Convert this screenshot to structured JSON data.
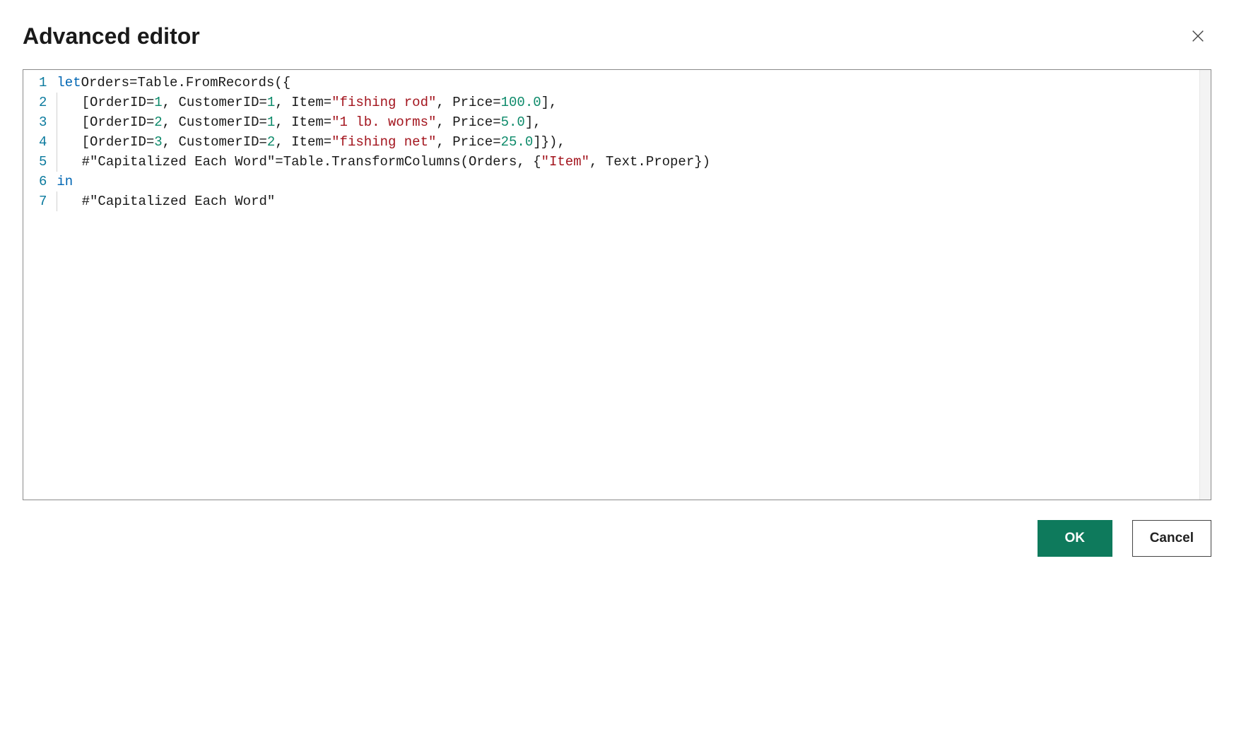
{
  "header": {
    "title": "Advanced editor"
  },
  "buttons": {
    "ok": "OK",
    "cancel": "Cancel"
  },
  "editor": {
    "line_numbers": [
      "1",
      "2",
      "3",
      "4",
      "5",
      "6",
      "7"
    ],
    "lines": [
      {
        "indent": 0,
        "tokens": [
          {
            "t": "kw",
            "v": "let"
          },
          {
            "t": "sp",
            "v": " "
          },
          {
            "t": "ident",
            "v": "Orders"
          },
          {
            "t": "sp",
            "v": " "
          },
          {
            "t": "punc",
            "v": "="
          },
          {
            "t": "sp",
            "v": " "
          },
          {
            "t": "ident",
            "v": "Table.FromRecords"
          },
          {
            "t": "punc",
            "v": "({"
          }
        ]
      },
      {
        "indent": 1,
        "tokens": [
          {
            "t": "punc",
            "v": "["
          },
          {
            "t": "ident",
            "v": "OrderID"
          },
          {
            "t": "sp",
            "v": " "
          },
          {
            "t": "punc",
            "v": "="
          },
          {
            "t": "sp",
            "v": " "
          },
          {
            "t": "num",
            "v": "1"
          },
          {
            "t": "punc",
            "v": ", "
          },
          {
            "t": "ident",
            "v": "CustomerID"
          },
          {
            "t": "sp",
            "v": " "
          },
          {
            "t": "punc",
            "v": "="
          },
          {
            "t": "sp",
            "v": " "
          },
          {
            "t": "num",
            "v": "1"
          },
          {
            "t": "punc",
            "v": ", "
          },
          {
            "t": "ident",
            "v": "Item"
          },
          {
            "t": "sp",
            "v": " "
          },
          {
            "t": "punc",
            "v": "="
          },
          {
            "t": "sp",
            "v": " "
          },
          {
            "t": "str",
            "v": "\"fishing rod\""
          },
          {
            "t": "punc",
            "v": ", "
          },
          {
            "t": "ident",
            "v": "Price"
          },
          {
            "t": "sp",
            "v": " "
          },
          {
            "t": "punc",
            "v": "="
          },
          {
            "t": "sp",
            "v": " "
          },
          {
            "t": "num",
            "v": "100.0"
          },
          {
            "t": "punc",
            "v": "],"
          }
        ]
      },
      {
        "indent": 1,
        "tokens": [
          {
            "t": "punc",
            "v": "["
          },
          {
            "t": "ident",
            "v": "OrderID"
          },
          {
            "t": "sp",
            "v": " "
          },
          {
            "t": "punc",
            "v": "="
          },
          {
            "t": "sp",
            "v": " "
          },
          {
            "t": "num",
            "v": "2"
          },
          {
            "t": "punc",
            "v": ", "
          },
          {
            "t": "ident",
            "v": "CustomerID"
          },
          {
            "t": "sp",
            "v": " "
          },
          {
            "t": "punc",
            "v": "="
          },
          {
            "t": "sp",
            "v": " "
          },
          {
            "t": "num",
            "v": "1"
          },
          {
            "t": "punc",
            "v": ", "
          },
          {
            "t": "ident",
            "v": "Item"
          },
          {
            "t": "sp",
            "v": " "
          },
          {
            "t": "punc",
            "v": "="
          },
          {
            "t": "sp",
            "v": " "
          },
          {
            "t": "str",
            "v": "\"1 lb. worms\""
          },
          {
            "t": "punc",
            "v": ", "
          },
          {
            "t": "ident",
            "v": "Price"
          },
          {
            "t": "sp",
            "v": " "
          },
          {
            "t": "punc",
            "v": "="
          },
          {
            "t": "sp",
            "v": " "
          },
          {
            "t": "num",
            "v": "5.0"
          },
          {
            "t": "punc",
            "v": "],"
          }
        ]
      },
      {
        "indent": 1,
        "tokens": [
          {
            "t": "punc",
            "v": "["
          },
          {
            "t": "ident",
            "v": "OrderID"
          },
          {
            "t": "sp",
            "v": " "
          },
          {
            "t": "punc",
            "v": "="
          },
          {
            "t": "sp",
            "v": " "
          },
          {
            "t": "num",
            "v": "3"
          },
          {
            "t": "punc",
            "v": ", "
          },
          {
            "t": "ident",
            "v": "CustomerID"
          },
          {
            "t": "sp",
            "v": " "
          },
          {
            "t": "punc",
            "v": "="
          },
          {
            "t": "sp",
            "v": " "
          },
          {
            "t": "num",
            "v": "2"
          },
          {
            "t": "punc",
            "v": ", "
          },
          {
            "t": "ident",
            "v": "Item"
          },
          {
            "t": "sp",
            "v": " "
          },
          {
            "t": "punc",
            "v": "="
          },
          {
            "t": "sp",
            "v": " "
          },
          {
            "t": "str",
            "v": "\"fishing net\""
          },
          {
            "t": "punc",
            "v": ", "
          },
          {
            "t": "ident",
            "v": "Price"
          },
          {
            "t": "sp",
            "v": " "
          },
          {
            "t": "punc",
            "v": "="
          },
          {
            "t": "sp",
            "v": " "
          },
          {
            "t": "num",
            "v": "25.0"
          },
          {
            "t": "punc",
            "v": "]}),"
          }
        ]
      },
      {
        "indent": 1,
        "tokens": [
          {
            "t": "ident",
            "v": "#\"Capitalized Each Word\""
          },
          {
            "t": "sp",
            "v": " "
          },
          {
            "t": "punc",
            "v": "="
          },
          {
            "t": "sp",
            "v": " "
          },
          {
            "t": "ident",
            "v": "Table.TransformColumns"
          },
          {
            "t": "punc",
            "v": "("
          },
          {
            "t": "ident",
            "v": "Orders"
          },
          {
            "t": "punc",
            "v": ", {"
          },
          {
            "t": "str",
            "v": "\"Item\""
          },
          {
            "t": "punc",
            "v": ", "
          },
          {
            "t": "ident",
            "v": "Text.Proper"
          },
          {
            "t": "punc",
            "v": "})"
          }
        ]
      },
      {
        "indent": 0,
        "tokens": [
          {
            "t": "kw",
            "v": "in"
          }
        ]
      },
      {
        "indent": 1,
        "tokens": [
          {
            "t": "ident",
            "v": "#\"Capitalized Each Word\""
          }
        ]
      }
    ]
  }
}
